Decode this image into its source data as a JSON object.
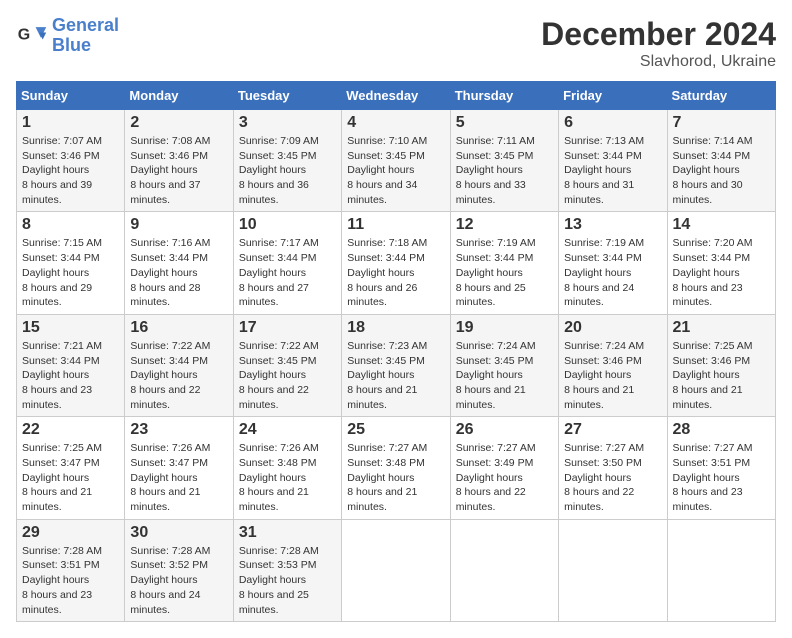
{
  "logo": {
    "line1": "General",
    "line2": "Blue"
  },
  "title": "December 2024",
  "subtitle": "Slavhorod, Ukraine",
  "days_of_week": [
    "Sunday",
    "Monday",
    "Tuesday",
    "Wednesday",
    "Thursday",
    "Friday",
    "Saturday"
  ],
  "weeks": [
    [
      {
        "day": "1",
        "sunrise": "7:07 AM",
        "sunset": "3:46 PM",
        "daylight": "8 hours and 39 minutes."
      },
      {
        "day": "2",
        "sunrise": "7:08 AM",
        "sunset": "3:46 PM",
        "daylight": "8 hours and 37 minutes."
      },
      {
        "day": "3",
        "sunrise": "7:09 AM",
        "sunset": "3:45 PM",
        "daylight": "8 hours and 36 minutes."
      },
      {
        "day": "4",
        "sunrise": "7:10 AM",
        "sunset": "3:45 PM",
        "daylight": "8 hours and 34 minutes."
      },
      {
        "day": "5",
        "sunrise": "7:11 AM",
        "sunset": "3:45 PM",
        "daylight": "8 hours and 33 minutes."
      },
      {
        "day": "6",
        "sunrise": "7:13 AM",
        "sunset": "3:44 PM",
        "daylight": "8 hours and 31 minutes."
      },
      {
        "day": "7",
        "sunrise": "7:14 AM",
        "sunset": "3:44 PM",
        "daylight": "8 hours and 30 minutes."
      }
    ],
    [
      {
        "day": "8",
        "sunrise": "7:15 AM",
        "sunset": "3:44 PM",
        "daylight": "8 hours and 29 minutes."
      },
      {
        "day": "9",
        "sunrise": "7:16 AM",
        "sunset": "3:44 PM",
        "daylight": "8 hours and 28 minutes."
      },
      {
        "day": "10",
        "sunrise": "7:17 AM",
        "sunset": "3:44 PM",
        "daylight": "8 hours and 27 minutes."
      },
      {
        "day": "11",
        "sunrise": "7:18 AM",
        "sunset": "3:44 PM",
        "daylight": "8 hours and 26 minutes."
      },
      {
        "day": "12",
        "sunrise": "7:19 AM",
        "sunset": "3:44 PM",
        "daylight": "8 hours and 25 minutes."
      },
      {
        "day": "13",
        "sunrise": "7:19 AM",
        "sunset": "3:44 PM",
        "daylight": "8 hours and 24 minutes."
      },
      {
        "day": "14",
        "sunrise": "7:20 AM",
        "sunset": "3:44 PM",
        "daylight": "8 hours and 23 minutes."
      }
    ],
    [
      {
        "day": "15",
        "sunrise": "7:21 AM",
        "sunset": "3:44 PM",
        "daylight": "8 hours and 23 minutes."
      },
      {
        "day": "16",
        "sunrise": "7:22 AM",
        "sunset": "3:44 PM",
        "daylight": "8 hours and 22 minutes."
      },
      {
        "day": "17",
        "sunrise": "7:22 AM",
        "sunset": "3:45 PM",
        "daylight": "8 hours and 22 minutes."
      },
      {
        "day": "18",
        "sunrise": "7:23 AM",
        "sunset": "3:45 PM",
        "daylight": "8 hours and 21 minutes."
      },
      {
        "day": "19",
        "sunrise": "7:24 AM",
        "sunset": "3:45 PM",
        "daylight": "8 hours and 21 minutes."
      },
      {
        "day": "20",
        "sunrise": "7:24 AM",
        "sunset": "3:46 PM",
        "daylight": "8 hours and 21 minutes."
      },
      {
        "day": "21",
        "sunrise": "7:25 AM",
        "sunset": "3:46 PM",
        "daylight": "8 hours and 21 minutes."
      }
    ],
    [
      {
        "day": "22",
        "sunrise": "7:25 AM",
        "sunset": "3:47 PM",
        "daylight": "8 hours and 21 minutes."
      },
      {
        "day": "23",
        "sunrise": "7:26 AM",
        "sunset": "3:47 PM",
        "daylight": "8 hours and 21 minutes."
      },
      {
        "day": "24",
        "sunrise": "7:26 AM",
        "sunset": "3:48 PM",
        "daylight": "8 hours and 21 minutes."
      },
      {
        "day": "25",
        "sunrise": "7:27 AM",
        "sunset": "3:48 PM",
        "daylight": "8 hours and 21 minutes."
      },
      {
        "day": "26",
        "sunrise": "7:27 AM",
        "sunset": "3:49 PM",
        "daylight": "8 hours and 22 minutes."
      },
      {
        "day": "27",
        "sunrise": "7:27 AM",
        "sunset": "3:50 PM",
        "daylight": "8 hours and 22 minutes."
      },
      {
        "day": "28",
        "sunrise": "7:27 AM",
        "sunset": "3:51 PM",
        "daylight": "8 hours and 23 minutes."
      }
    ],
    [
      {
        "day": "29",
        "sunrise": "7:28 AM",
        "sunset": "3:51 PM",
        "daylight": "8 hours and 23 minutes."
      },
      {
        "day": "30",
        "sunrise": "7:28 AM",
        "sunset": "3:52 PM",
        "daylight": "8 hours and 24 minutes."
      },
      {
        "day": "31",
        "sunrise": "7:28 AM",
        "sunset": "3:53 PM",
        "daylight": "8 hours and 25 minutes."
      },
      null,
      null,
      null,
      null
    ]
  ]
}
